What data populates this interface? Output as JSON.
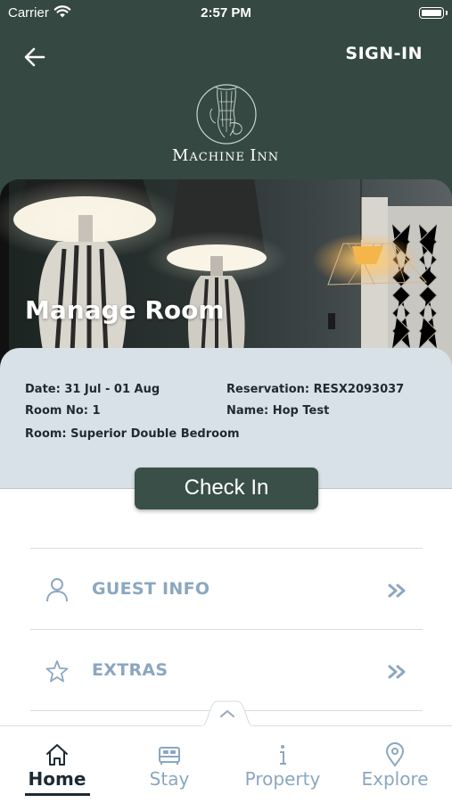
{
  "status_bar": {
    "carrier": "Carrier",
    "time": "2:57 PM"
  },
  "header": {
    "back_icon": "arrow-left-icon",
    "signin_label": "SIGN-IN",
    "logo_text": "Machine Inn"
  },
  "hero": {
    "title": "Manage Room"
  },
  "reservation": {
    "date": "Date: 31 Jul - 01 Aug",
    "reservation_no": "Reservation: RESX2093037",
    "room_no": "Room No: 1",
    "name": "Name: Hop Test",
    "room_type": "Room: Superior Double Bedroom"
  },
  "checkin_label": "Check In",
  "menu": [
    {
      "label": "GUEST INFO",
      "icon": "person-icon",
      "chevron": "double-chevron-right-icon"
    },
    {
      "label": "EXTRAS",
      "icon": "star-icon",
      "chevron": "double-chevron-right-icon"
    }
  ],
  "tabs": [
    {
      "label": "Home",
      "icon": "home-icon",
      "active": true
    },
    {
      "label": "Stay",
      "icon": "bed-icon",
      "active": false
    },
    {
      "label": "Property",
      "icon": "info-icon",
      "active": false
    },
    {
      "label": "Explore",
      "icon": "location-pin-icon",
      "active": false
    }
  ],
  "colors": {
    "header_bg": "#354841",
    "card_bg": "#d9e1e8",
    "button_bg": "#3a4f47",
    "accent_text": "#8ba7c0",
    "active_tab": "#1e2a33"
  }
}
